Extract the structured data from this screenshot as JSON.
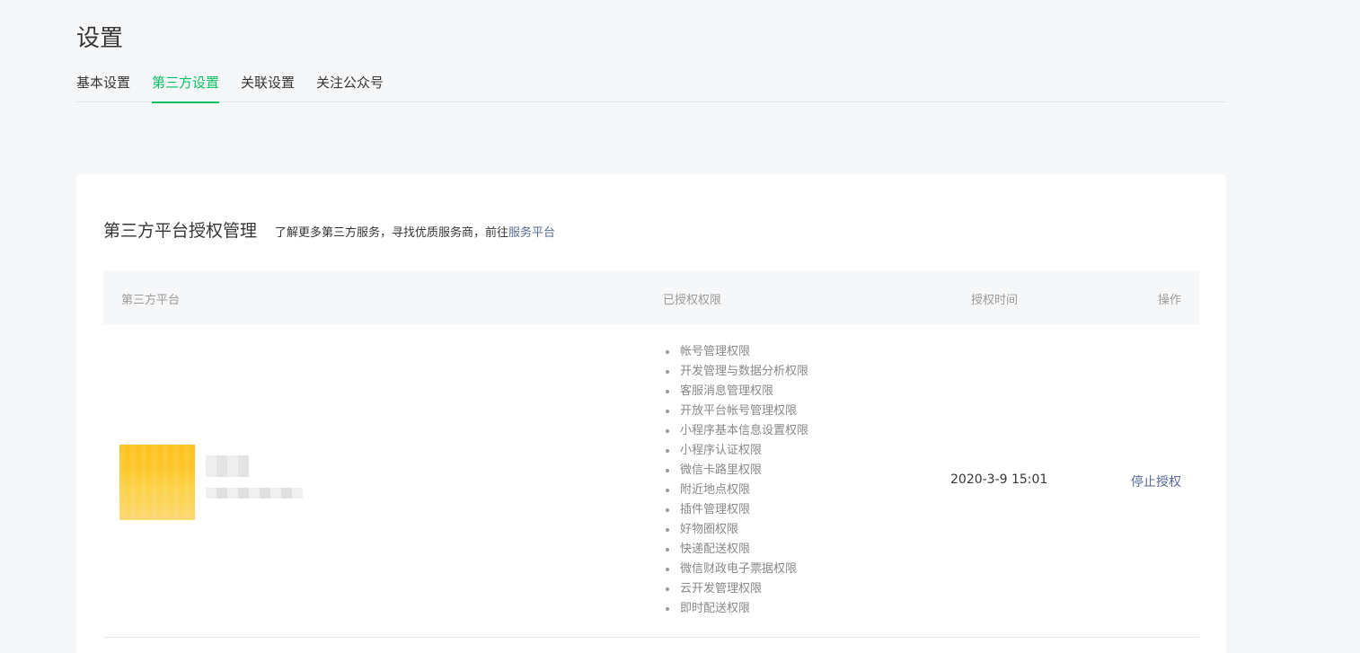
{
  "page_title": "设置",
  "tabs": [
    {
      "label": "基本设置",
      "active": false
    },
    {
      "label": "第三方设置",
      "active": true
    },
    {
      "label": "关联设置",
      "active": false
    },
    {
      "label": "关注公众号",
      "active": false
    }
  ],
  "colors": {
    "accent": "#07c160",
    "link": "#576b95",
    "background": "#f6f7f9"
  },
  "card": {
    "title": "第三方平台授权管理",
    "desc_text": "了解更多第三方服务，寻找优质服务商，前往",
    "desc_link": "服务平台"
  },
  "table": {
    "headers": {
      "platform": "第三方平台",
      "permissions": "已授权权限",
      "time": "授权时间",
      "operation": "操作"
    },
    "rows": [
      {
        "permissions": [
          "帐号管理权限",
          "开发管理与数据分析权限",
          "客服消息管理权限",
          "开放平台帐号管理权限",
          "小程序基本信息设置权限",
          "小程序认证权限",
          "微信卡路里权限",
          "附近地点权限",
          "插件管理权限",
          "好物圈权限",
          "快递配送权限",
          "微信财政电子票据权限",
          "云开发管理权限",
          "即时配送权限"
        ],
        "time": "2020-3-9 15:01",
        "action_label": "停止授权"
      }
    ]
  }
}
